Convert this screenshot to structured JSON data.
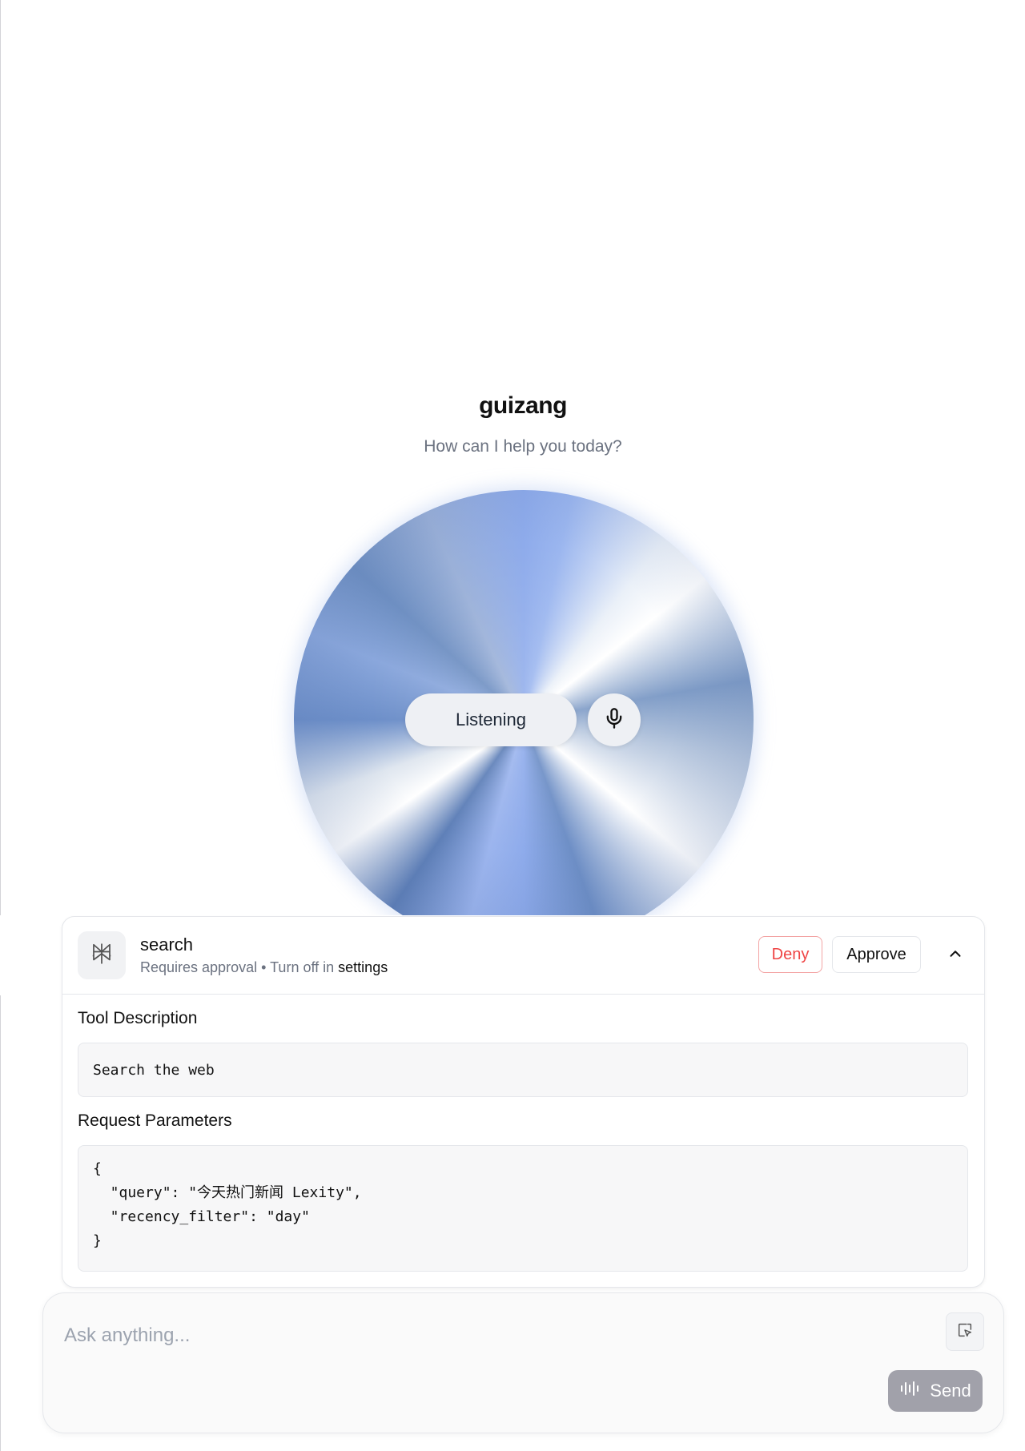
{
  "header": {
    "title": "guizang",
    "subtitle": "How can I help you today?"
  },
  "voice": {
    "status_label": "Listening",
    "orb_colors": [
      "#8eabeb",
      "#6e8fc6",
      "#ffffff"
    ]
  },
  "tool_call": {
    "name": "search",
    "requires_text": "Requires approval",
    "separator": "•",
    "turn_off_text": "Turn off in",
    "settings_link": "settings",
    "deny_label": "Deny",
    "approve_label": "Approve",
    "description_title": "Tool Description",
    "description_value": "Search the web",
    "params_title": "Request Parameters",
    "params_lines": [
      "{",
      "  \"query\": \"今天热门新闻 Lexity\",",
      "  \"recency_filter\": \"day\"",
      "}"
    ]
  },
  "composer": {
    "placeholder": "Ask anything...",
    "send_label": "Send"
  },
  "colors": {
    "deny": "#ef4444",
    "send_bg": "#a1a1aa",
    "muted_text": "#6b7280"
  },
  "icons": [
    "perplexity-logo-icon",
    "microphone-icon",
    "chevron-up-icon",
    "cursor-select-icon",
    "audio-wave-icon"
  ]
}
